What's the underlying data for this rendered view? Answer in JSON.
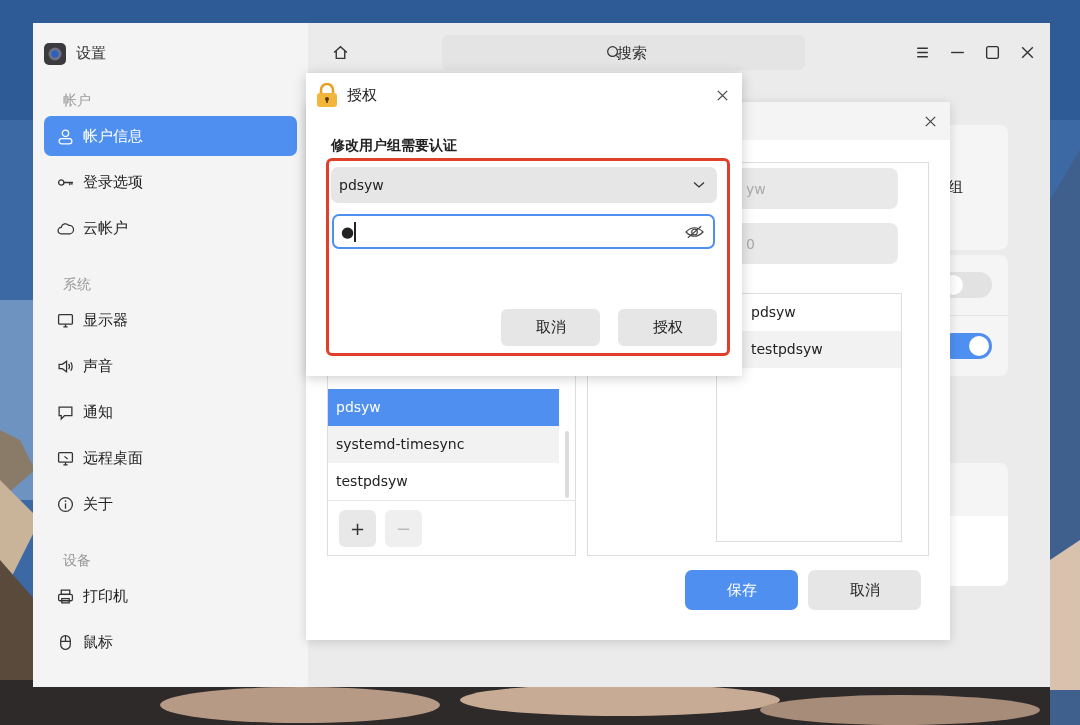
{
  "window": {
    "title": "设置"
  },
  "sidebar": {
    "sections": [
      {
        "label": "帐户",
        "items": [
          {
            "label": "帐户信息",
            "selected": true
          },
          {
            "label": "登录选项",
            "selected": false
          },
          {
            "label": "云帐户",
            "selected": false
          }
        ]
      },
      {
        "label": "系统",
        "items": [
          {
            "label": "显示器",
            "selected": false
          },
          {
            "label": "声音",
            "selected": false
          },
          {
            "label": "通知",
            "selected": false
          },
          {
            "label": "远程桌面",
            "selected": false
          },
          {
            "label": "关于",
            "selected": false
          }
        ]
      },
      {
        "label": "设备",
        "items": [
          {
            "label": "打印机",
            "selected": false
          },
          {
            "label": "鼠标",
            "selected": false
          }
        ]
      }
    ]
  },
  "toolbar": {
    "search": {
      "placeholder": "搜索"
    }
  },
  "cards": [
    {
      "rows": [
        {
          "kind": "label",
          "text": "组"
        }
      ]
    },
    {
      "rows": [
        {
          "kind": "toggle",
          "on": false
        },
        {
          "kind": "toggle",
          "on": true
        }
      ]
    },
    {
      "rows": [
        {
          "kind": "blank"
        },
        {
          "kind": "blank"
        }
      ]
    }
  ],
  "group_dialog": {
    "groups": [
      {
        "label": "pdsyw",
        "selected": true,
        "hovered": false
      },
      {
        "label": "systemd-timesync",
        "selected": false,
        "hovered": true
      },
      {
        "label": "testpdsyw",
        "selected": false,
        "hovered": false
      }
    ],
    "add_button": {
      "label": "+",
      "disabled": false
    },
    "remove_button": {
      "label": "−",
      "disabled": true
    },
    "fields": [
      {
        "value": "yw",
        "disabled": true
      },
      {
        "value": "0",
        "disabled": true
      }
    ],
    "members": [
      {
        "label": "pdsyw",
        "hovered": false
      },
      {
        "label": "testpdsyw",
        "hovered": true
      }
    ],
    "buttons": [
      {
        "label": "保存",
        "kind": "primary"
      },
      {
        "label": "取消",
        "kind": "secondary"
      }
    ]
  },
  "auth_dialog": {
    "title": "授权",
    "prompt": "修改用户组需要认证",
    "user_select": {
      "value": "pdsyw"
    },
    "password": {
      "value": "●"
    },
    "buttons": [
      {
        "label": "取消"
      },
      {
        "label": "授权"
      }
    ]
  }
}
